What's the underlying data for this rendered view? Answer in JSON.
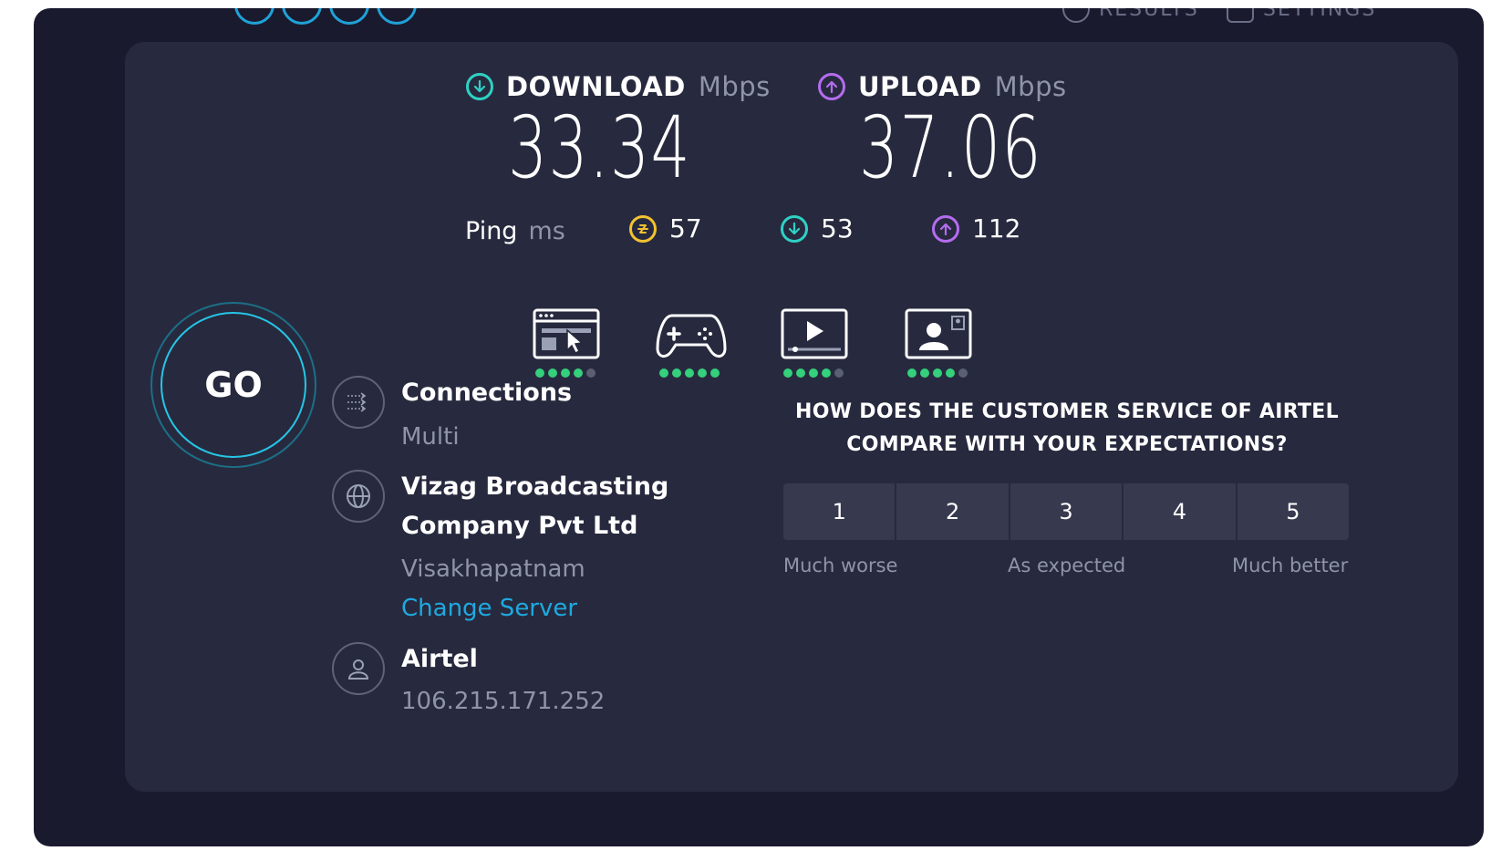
{
  "header": {
    "results_label": "RESULTS",
    "settings_label": "SETTINGS"
  },
  "download": {
    "label": "DOWNLOAD",
    "unit": "Mbps",
    "value": "33.34",
    "color": "#2fd1c5"
  },
  "upload": {
    "label": "UPLOAD",
    "unit": "Mbps",
    "value": "37.06",
    "color": "#b56cf0"
  },
  "ping": {
    "label": "Ping",
    "unit": "ms",
    "idle": {
      "value": "57",
      "color": "#f2c230"
    },
    "download": {
      "value": "53",
      "color": "#2fd1c5"
    },
    "upload": {
      "value": "112",
      "color": "#b56cf0"
    }
  },
  "performance": [
    {
      "name": "web-browsing-icon",
      "rating": 4,
      "max": 5
    },
    {
      "name": "gaming-icon",
      "rating": 5,
      "max": 5
    },
    {
      "name": "video-streaming-icon",
      "rating": 4,
      "max": 5
    },
    {
      "name": "video-call-icon",
      "rating": 4,
      "max": 5
    }
  ],
  "go_button": {
    "label": "GO"
  },
  "connections": {
    "title": "Connections",
    "value": "Multi"
  },
  "server": {
    "name_line1": "Vizag Broadcasting",
    "name_line2": "Company Pvt Ltd",
    "location": "Visakhapatnam",
    "change_label": "Change Server"
  },
  "provider": {
    "name": "Airtel",
    "ip": "106.215.171.252"
  },
  "survey": {
    "question_line1": "HOW DOES THE CUSTOMER SERVICE OF AIRTEL",
    "question_line2": "COMPARE WITH YOUR EXPECTATIONS?",
    "options": [
      "1",
      "2",
      "3",
      "4",
      "5"
    ],
    "label_low": "Much worse",
    "label_mid": "As expected",
    "label_high": "Much better"
  }
}
